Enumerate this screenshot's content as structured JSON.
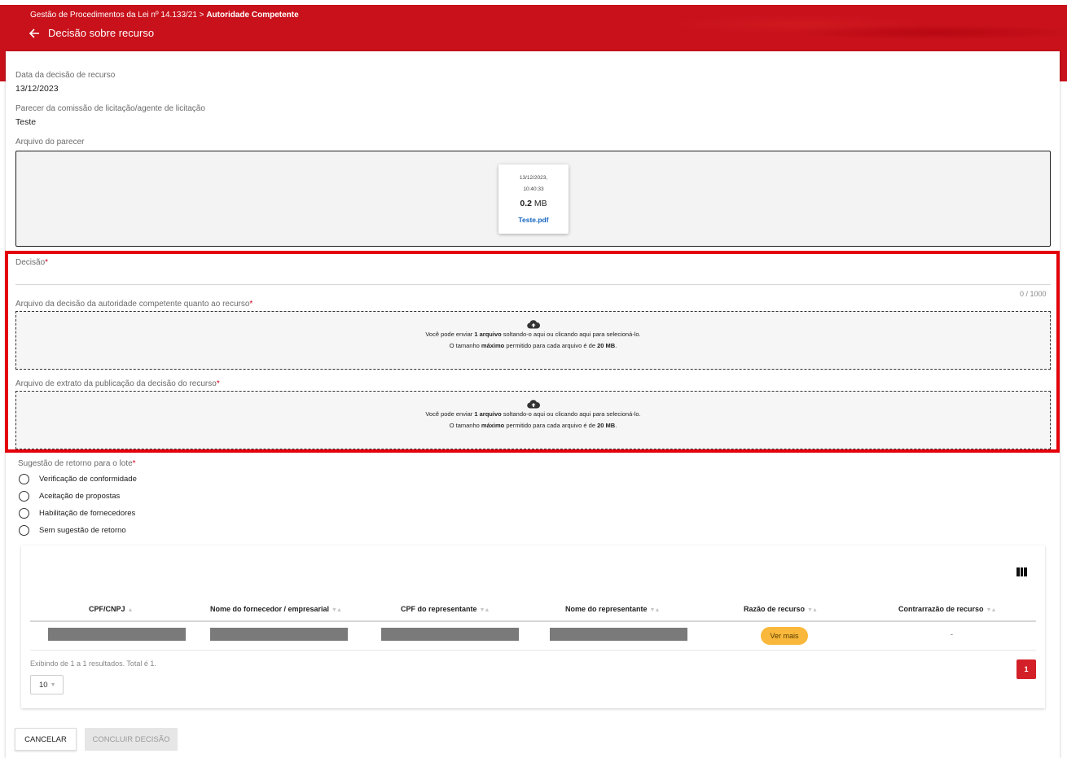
{
  "header": {
    "breadcrumb_prefix": "Gestão de Procedimentos da Lei nº 14.133/21 > ",
    "breadcrumb_current": "Autoridade Competente",
    "title": "Decisão sobre recurso",
    "brand_color": "#c8111b"
  },
  "fields": {
    "data_decisao_label": "Data da decisão de recurso",
    "data_decisao_value": "13/12/2023",
    "parecer_label": "Parecer da comissão de licitação/agente de licitação",
    "parecer_value": "Teste",
    "arquivo_parecer_label": "Arquivo do parecer"
  },
  "file": {
    "date_line1": "13/12/2023,",
    "date_line2": "10:40:33",
    "size_value": "0.2",
    "size_unit": " MB",
    "name": "Teste.pdf"
  },
  "decisao": {
    "label": "Decisão",
    "required_mark": "*",
    "counter": "0 / 1000"
  },
  "upload_decisao": {
    "label": "Arquivo da decisão da autoridade competente quanto ao recurso",
    "required_mark": "*"
  },
  "upload_extrato": {
    "label": "Arquivo de extrato da publicação da decisão do recurso",
    "required_mark": "*"
  },
  "dropzone": {
    "line1_a": "Você pode enviar ",
    "line1_b": "1 arquivo",
    "line1_c": " soltando-o aqui ou clicando aqui para selecioná-lo.",
    "line2_a": "O tamanho ",
    "line2_b": "máximo",
    "line2_c": " permitido para cada arquivo é de ",
    "line2_d": "20 MB",
    "line2_e": "."
  },
  "retorno": {
    "label": "Sugestão de retorno para o lote",
    "required_mark": "*",
    "options": [
      "Verificação de conformidade",
      "Aceitação de propostas",
      "Habilitação de fornecedores",
      "Sem sugestão de retorno"
    ]
  },
  "table": {
    "columns": [
      "CPF/CNPJ",
      "Nome do fornecedor / empresarial",
      "CPF do representante",
      "Nome do representante",
      "Razão de recurso",
      "Contrarrazão de recurso"
    ],
    "row": {
      "razao_button": "Ver mais",
      "contrarrazao": "-"
    },
    "showing": "Exibindo de 1 a 1 resultados. Total é 1.",
    "current_page": "1",
    "page_size": "10"
  },
  "actions": {
    "cancel": "CANCELAR",
    "conclude": "CONCLUIR DECISÃO"
  }
}
